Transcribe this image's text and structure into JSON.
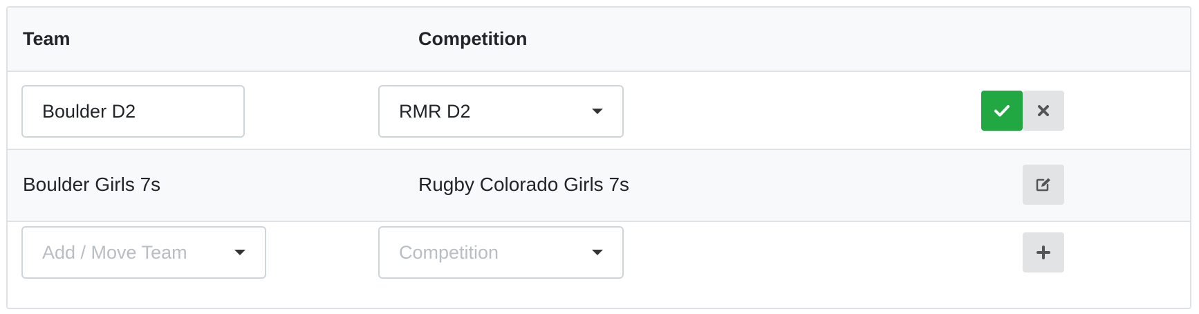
{
  "table": {
    "headers": {
      "team": "Team",
      "competition": "Competition"
    },
    "edit_row": {
      "team_value": "Boulder D2",
      "competition_value": "RMR D2",
      "save_icon": "check-icon",
      "cancel_icon": "close-icon"
    },
    "rows": [
      {
        "team": "Boulder Girls 7s",
        "competition": "Rugby Colorado Girls 7s",
        "action_icon": "edit-icon"
      }
    ],
    "add_row": {
      "team_placeholder": "Add / Move Team",
      "competition_placeholder": "Competition",
      "add_icon": "plus-icon"
    }
  },
  "colors": {
    "success": "#21a843",
    "button_light": "#e2e3e5",
    "border": "#dee2e6",
    "striped_row": "#f8f9fa"
  }
}
